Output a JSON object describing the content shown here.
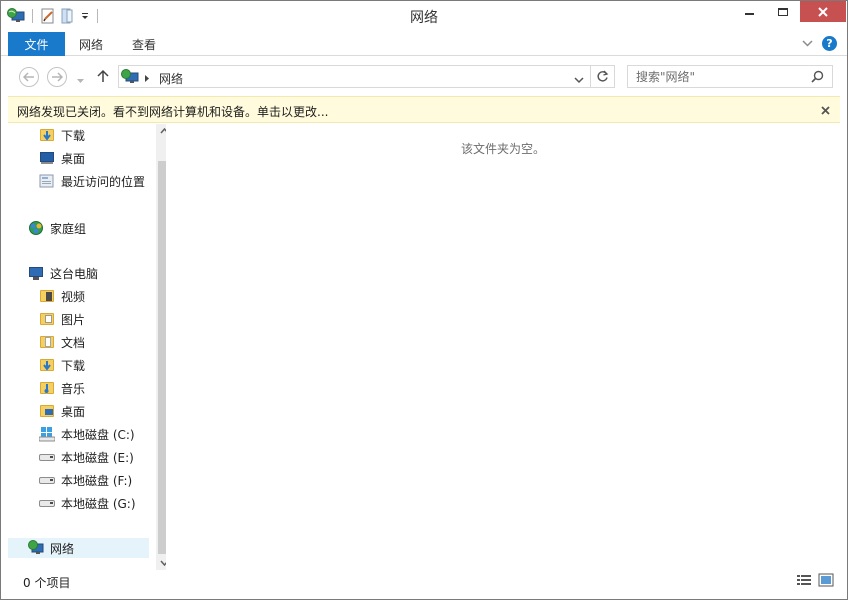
{
  "window": {
    "title": "网络"
  },
  "ribbon": {
    "tabs": [
      "文件",
      "网络",
      "查看"
    ]
  },
  "address": {
    "breadcrumb": "网络"
  },
  "search": {
    "placeholder": "搜索\"网络\""
  },
  "infobar": {
    "message": "网络发现已关闭。看不到网络计算机和设备。单击以更改..."
  },
  "navpane": {
    "favorites": [
      "下载",
      "桌面",
      "最近访问的位置"
    ],
    "homegroup": "家庭组",
    "this_pc": "这台电脑",
    "this_pc_items": [
      "视频",
      "图片",
      "文档",
      "下载",
      "音乐",
      "桌面"
    ],
    "drives": [
      "本地磁盘 (C:)",
      "本地磁盘 (E:)",
      "本地磁盘 (F:)",
      "本地磁盘 (G:)"
    ],
    "network": "网络"
  },
  "content": {
    "empty_message": "该文件夹为空。"
  },
  "status": {
    "item_count": "0 个项目"
  },
  "colors": {
    "accent": "#1979ca",
    "infobar_bg": "#fffbdc",
    "close_button": "#c75050"
  }
}
